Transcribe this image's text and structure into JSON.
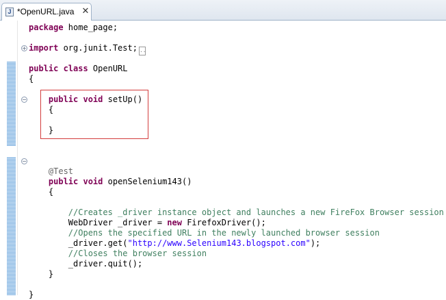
{
  "tab": {
    "title": "*OpenURL.java",
    "icon": "java-file-icon",
    "icon_glyph": "J",
    "close_glyph": "✕"
  },
  "editor": {
    "collapsed_marker": "..",
    "lines": [
      {
        "id": "package",
        "parts": [
          {
            "t": "kw",
            "v": "package"
          },
          {
            "t": "",
            "v": " home_page;"
          }
        ]
      },
      {
        "id": "blank1",
        "parts": []
      },
      {
        "id": "import",
        "parts": [
          {
            "t": "kw",
            "v": "import"
          },
          {
            "t": "",
            "v": " org.junit.Test;"
          }
        ],
        "collapsed": true
      },
      {
        "id": "blank2",
        "parts": []
      },
      {
        "id": "class-decl",
        "parts": [
          {
            "t": "kw",
            "v": "public class"
          },
          {
            "t": "",
            "v": " OpenURL"
          }
        ]
      },
      {
        "id": "class-open",
        "parts": [
          {
            "t": "",
            "v": "{"
          }
        ]
      },
      {
        "id": "blank3",
        "parts": []
      },
      {
        "id": "setup-decl",
        "parts": [
          {
            "t": "",
            "v": "    "
          },
          {
            "t": "kw",
            "v": "public void"
          },
          {
            "t": "",
            "v": " setUp()"
          }
        ]
      },
      {
        "id": "setup-open",
        "parts": [
          {
            "t": "",
            "v": "    {"
          }
        ]
      },
      {
        "id": "setup-body",
        "parts": []
      },
      {
        "id": "setup-close",
        "parts": [
          {
            "t": "",
            "v": "    }"
          }
        ]
      },
      {
        "id": "blank4",
        "parts": []
      },
      {
        "id": "blank5",
        "parts": []
      },
      {
        "id": "blank6",
        "parts": []
      },
      {
        "id": "annotation",
        "parts": [
          {
            "t": "ann",
            "v": "    @Test"
          }
        ]
      },
      {
        "id": "method-decl",
        "parts": [
          {
            "t": "",
            "v": "    "
          },
          {
            "t": "kw",
            "v": "public void"
          },
          {
            "t": "",
            "v": " openSelenium143()"
          }
        ]
      },
      {
        "id": "method-open",
        "parts": [
          {
            "t": "",
            "v": "    {"
          }
        ]
      },
      {
        "id": "blank7",
        "parts": []
      },
      {
        "id": "comment1",
        "parts": [
          {
            "t": "cm",
            "v": "        //Creates _driver instance object and launches a new FireFox Browser session"
          }
        ]
      },
      {
        "id": "driver-init",
        "parts": [
          {
            "t": "",
            "v": "        WebDriver _driver = "
          },
          {
            "t": "kw",
            "v": "new"
          },
          {
            "t": "",
            "v": " FirefoxDriver();"
          }
        ]
      },
      {
        "id": "comment2",
        "parts": [
          {
            "t": "cm",
            "v": "        //Opens the specified URL in the newly launched browser session"
          }
        ]
      },
      {
        "id": "driver-get",
        "parts": [
          {
            "t": "",
            "v": "        _driver.get("
          },
          {
            "t": "str",
            "v": "\"http://www.Selenium143.blogspot.com\""
          },
          {
            "t": "",
            "v": ");"
          }
        ]
      },
      {
        "id": "comment3",
        "parts": [
          {
            "t": "cm",
            "v": "        //Closes the browser session"
          }
        ]
      },
      {
        "id": "driver-quit",
        "parts": [
          {
            "t": "",
            "v": "        _driver.quit();"
          }
        ]
      },
      {
        "id": "method-close",
        "parts": [
          {
            "t": "",
            "v": "    }"
          }
        ]
      },
      {
        "id": "blank8",
        "parts": []
      },
      {
        "id": "class-close",
        "parts": [
          {
            "t": "",
            "v": "}"
          }
        ]
      }
    ]
  }
}
